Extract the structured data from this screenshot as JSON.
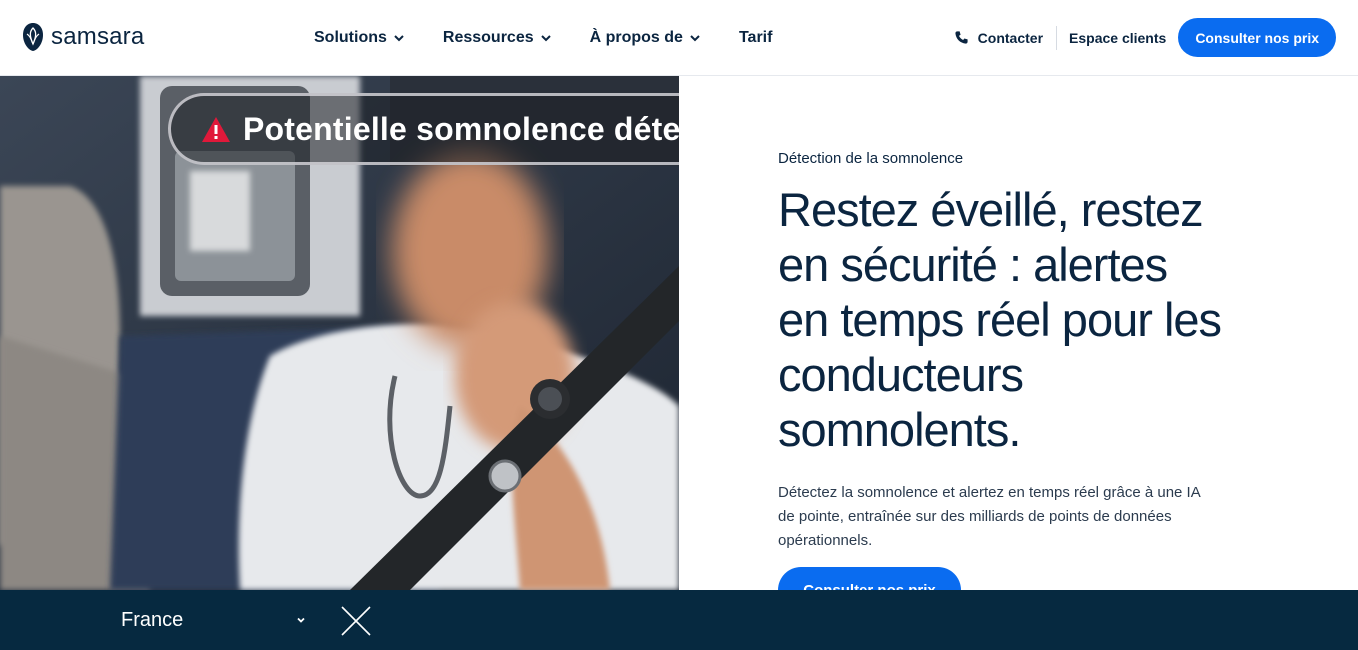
{
  "header": {
    "brand": "samsara",
    "nav": [
      {
        "label": "Solutions",
        "has_dropdown": true
      },
      {
        "label": "Ressources",
        "has_dropdown": true
      },
      {
        "label": "À propos de",
        "has_dropdown": true
      },
      {
        "label": "Tarif",
        "has_dropdown": false
      }
    ],
    "contact_label": "Contacter",
    "client_label": "Espace clients",
    "cta_label": "Consulter nos prix"
  },
  "hero": {
    "alert_text": "Potentielle somnolence déte",
    "eyebrow": "Détection de la somnolence",
    "headline": "Restez éveillé, restez en sécurité : alertes en temps réel pour les conducteurs somnolents.",
    "body": "Détectez la somnolence et alertez en temps réel grâce à une IA de pointe, entraînée sur des milliards de points de données opérationnels.",
    "cta_label": "Consulter nos prix"
  },
  "locale_bar": {
    "selected": "France"
  },
  "colors": {
    "accent": "#0a6cf0",
    "navy": "#0b2540",
    "bar": "#062940",
    "alert_red": "#e0193a"
  },
  "icons": [
    "samsara-logo-icon",
    "chevron-down-icon",
    "phone-icon",
    "warning-icon",
    "close-icon"
  ]
}
